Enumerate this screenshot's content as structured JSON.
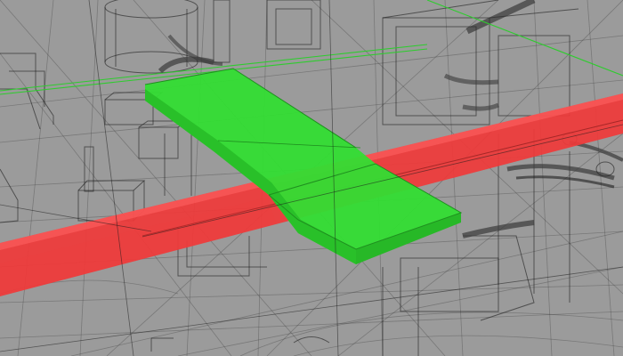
{
  "scene": {
    "background_color": "#9a9a9a",
    "wireframe_color": "#1a1a1a",
    "green_element_color": "#2fe02f",
    "red_element_color": "#f03a3a",
    "guide_line_color": "#2ecc2e"
  }
}
